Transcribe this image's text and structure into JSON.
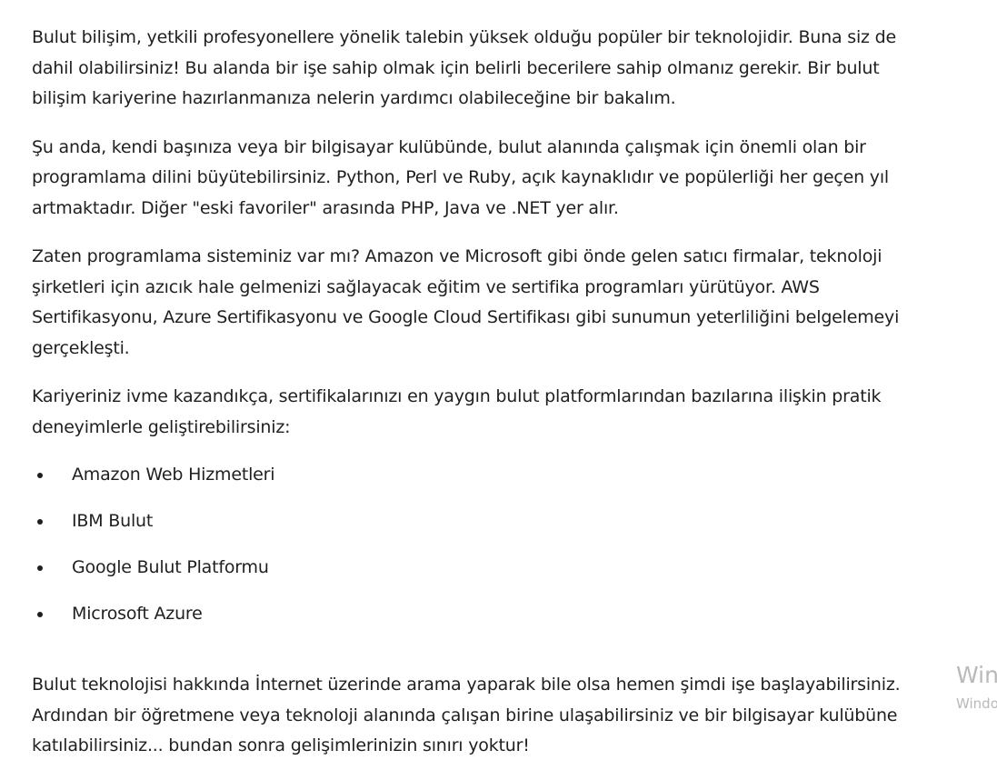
{
  "article": {
    "paragraphs": [
      "Bulut bilişim, yetkili profesyonellere yönelik talebin yüksek olduğu popüler bir teknolojidir. Buna siz de dahil olabilirsiniz! Bu alanda bir işe sahip olmak için belirli becerilere sahip olmanız gerekir. Bir bulut bilişim kariyerine hazırlanmanıza nelerin yardımcı olabileceğine bir bakalım.",
      "Şu anda, kendi başınıza veya bir bilgisayar kulübünde, bulut alanında çalışmak için önemli olan bir programlama dilini büyütebilirsiniz. Python, Perl ve Ruby, açık kaynaklıdır ve popülerliği her geçen yıl artmaktadır. Diğer \"eski favoriler\" arasında PHP, Java ve .NET yer alır.",
      "Zaten programlama sisteminiz var mı? Amazon ve Microsoft gibi önde gelen satıcı firmalar, teknoloji şirketleri için azıcık hale gelmenizi sağlayacak eğitim ve sertifika programları yürütüyor. AWS Sertifikasyonu, Azure Sertifikasyonu ve Google Cloud Sertifikası gibi sunumun yeterliliğini belgelemeyi gerçekleşti.",
      "Kariyeriniz ivme kazandıkça, sertifikalarınızı en yaygın bulut platformlarından bazılarına ilişkin pratik deneyimlerle geliştirebilirsiniz:"
    ],
    "list_items": [
      "Amazon Web Hizmetleri",
      "IBM Bulut",
      "Google Bulut Platformu",
      "Microsoft Azure"
    ],
    "closing_paragraph": "Bulut teknolojisi hakkında İnternet üzerinde arama yaparak bile olsa hemen şimdi işe başlayabilirsiniz. Ardından bir öğretmene veya teknoloji alanında çalışan birine ulaşabilirsiniz ve bir bilgisayar kulübüne katılabilirsiniz... bundan sonra gelişimlerinizin sınırı yoktur!"
  },
  "watermark": {
    "line1": "Wind",
    "line2": "Windo"
  }
}
